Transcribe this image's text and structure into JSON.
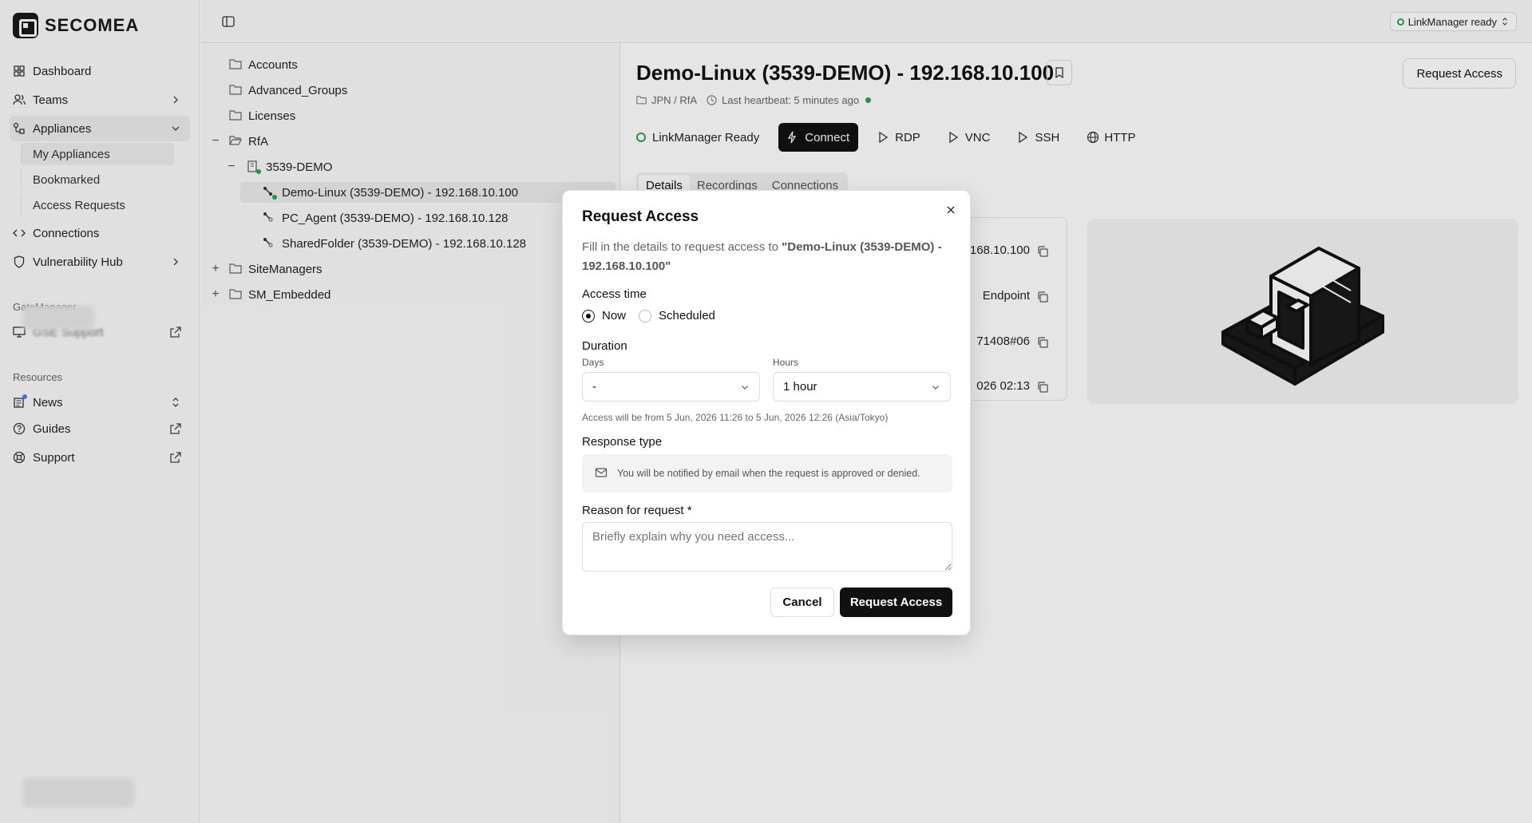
{
  "app": {
    "brand": "SECOMEA"
  },
  "topbar": {
    "linkmanager_status": "LinkManager ready"
  },
  "sidebar": {
    "items": [
      {
        "label": "Dashboard"
      },
      {
        "label": "Teams"
      },
      {
        "label": "Appliances"
      },
      {
        "label": "Connections"
      },
      {
        "label": "Vulnerability Hub"
      }
    ],
    "appliances_sub": [
      {
        "label": "My Appliances"
      },
      {
        "label": "Bookmarked"
      },
      {
        "label": "Access Requests"
      }
    ],
    "gatemanager_label": "GateManager",
    "gatemanager_item": "GSE Support",
    "resources_label": "Resources",
    "resources": [
      {
        "label": "News"
      },
      {
        "label": "Guides"
      },
      {
        "label": "Support"
      }
    ]
  },
  "tree": {
    "rows": [
      {
        "label": "Accounts"
      },
      {
        "label": "Advanced_Groups"
      },
      {
        "label": "Licenses"
      },
      {
        "label": "RfA"
      },
      {
        "label": "3539-DEMO"
      },
      {
        "label": "Demo-Linux (3539-DEMO) - 192.168.10.100"
      },
      {
        "label": "PC_Agent (3539-DEMO) - 192.168.10.128"
      },
      {
        "label": "SharedFolder (3539-DEMO) - 192.168.10.128"
      },
      {
        "label": "SiteManagers"
      },
      {
        "label": "SM_Embedded"
      }
    ]
  },
  "device": {
    "title": "Demo-Linux (3539-DEMO) - 192.168.10.100",
    "request_access_label": "Request Access",
    "path": "JPN / RfA",
    "heartbeat": "Last heartbeat: 5 minutes ago",
    "status": "LinkManager Ready",
    "actions": {
      "connect": "Connect",
      "rdp": "RDP",
      "vnc": "VNC",
      "ssh": "SSH",
      "http": "HTTP"
    },
    "tabs": [
      "Details",
      "Recordings",
      "Connections"
    ],
    "info_values": [
      "168.10.100",
      "Endpoint",
      "71408#06",
      "026 02:13"
    ]
  },
  "modal": {
    "title": "Request Access",
    "description_prefix": "Fill in the details to request access to ",
    "description_target": "\"Demo-Linux (3539-DEMO) - 192.168.10.100\"",
    "access_time_label": "Access time",
    "access_now": "Now",
    "access_scheduled": "Scheduled",
    "access_selected": "Now",
    "duration_label": "Duration",
    "days_label": "Days",
    "days_value": "-",
    "hours_label": "Hours",
    "hours_value": "1 hour",
    "access_window": "Access will be from 5 Jun, 2026 11:26 to 5 Jun, 2026 12:26 (Asia/Tokyo)",
    "response_type_label": "Response type",
    "response_type_text": "You will be notified by email when the request is approved or denied.",
    "reason_label": "Reason for request *",
    "reason_placeholder": "Briefly explain why you need access...",
    "cancel_label": "Cancel",
    "submit_label": "Request Access"
  },
  "colors": {
    "accent_green": "#2ca24a",
    "primary_dark": "#111111"
  }
}
